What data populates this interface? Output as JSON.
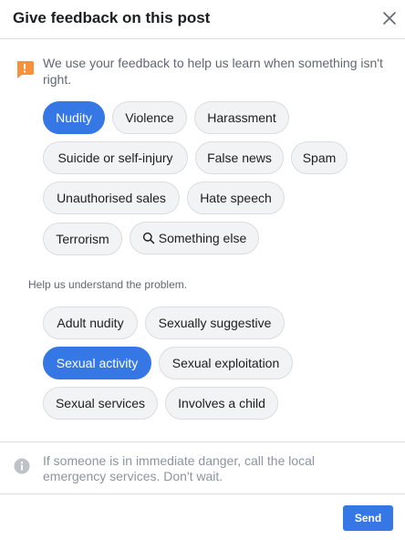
{
  "dialog": {
    "title": "Give feedback on this post",
    "notice": "We use your feedback to help us learn when something isn't right."
  },
  "categories": [
    {
      "label": "Nudity",
      "selected": true
    },
    {
      "label": "Violence",
      "selected": false
    },
    {
      "label": "Harassment",
      "selected": false
    },
    {
      "label": "Suicide or self-injury",
      "selected": false
    },
    {
      "label": "False news",
      "selected": false
    },
    {
      "label": "Spam",
      "selected": false
    },
    {
      "label": "Unauthorised sales",
      "selected": false
    },
    {
      "label": "Hate speech",
      "selected": false
    },
    {
      "label": "Terrorism",
      "selected": false
    },
    {
      "label": "Something else",
      "selected": false,
      "icon": "search-icon"
    }
  ],
  "problem": {
    "prompt": "Help us understand the problem.",
    "options": [
      {
        "label": "Adult nudity",
        "selected": false
      },
      {
        "label": "Sexually suggestive",
        "selected": false
      },
      {
        "label": "Sexual activity",
        "selected": true
      },
      {
        "label": "Sexual exploitation",
        "selected": false
      },
      {
        "label": "Sexual services",
        "selected": false
      },
      {
        "label": "Involves a child",
        "selected": false
      }
    ]
  },
  "footer": {
    "emergency_text": "If someone is in immediate danger, call the local emergency services. Don't wait.",
    "send_label": "Send"
  },
  "colors": {
    "accent": "#3578e5",
    "warning": "#f7923b",
    "chip_bg": "#f2f3f5"
  }
}
